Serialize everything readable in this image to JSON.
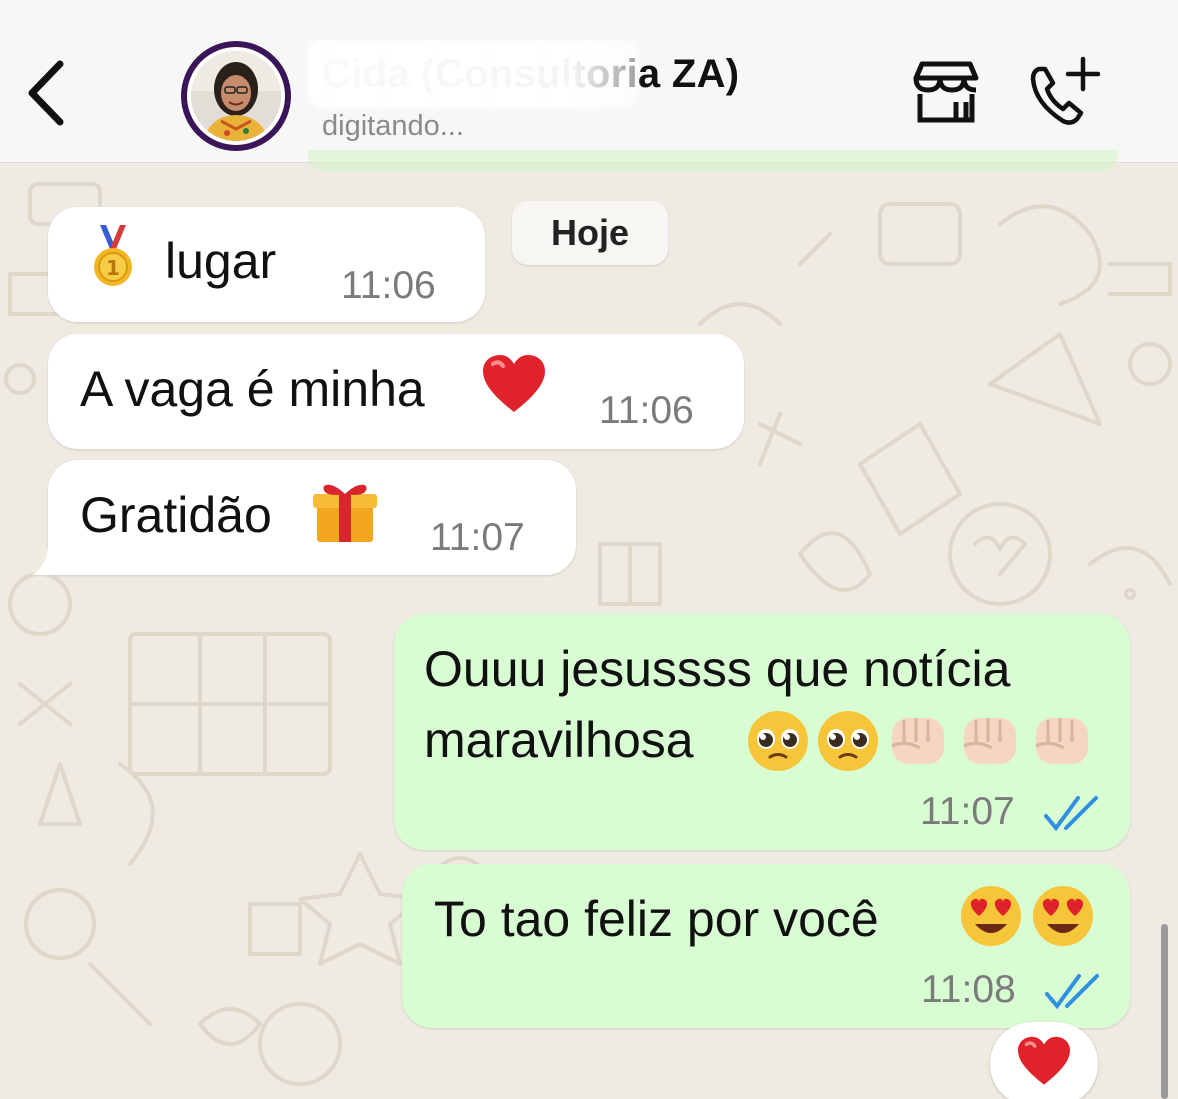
{
  "header": {
    "contact_name": "Cida (Consultoria ZA)",
    "status": "digitando...",
    "back_icon": "chevron-left-icon",
    "store_icon": "storefront-icon",
    "call_icon": "add-call-icon"
  },
  "chat": {
    "date_label": "Hoje",
    "incoming": [
      {
        "text": "lugar",
        "emoji": "medal",
        "time": "11:06"
      },
      {
        "text": "A vaga é minha",
        "emoji": "heart",
        "time": "11:06"
      },
      {
        "text": "Gratidão",
        "emoji": "gift",
        "time": "11:07"
      }
    ],
    "outgoing": [
      {
        "line1": "Ouuu jesussss que notícia",
        "line2": "maravilhosa",
        "emoji": "pleading-faces-and-fists",
        "time": "11:07",
        "status": "read"
      },
      {
        "text": "To tao feliz por você",
        "emoji": "heart-eyes",
        "time": "11:08",
        "status": "read"
      }
    ],
    "reaction": "heart"
  },
  "colors": {
    "incoming_bubble": "#ffffff",
    "outgoing_bubble": "#d9fdd3",
    "read_ticks": "#2f8fe0",
    "wallpaper": "#efeae2",
    "avatar_ring": "#3b1559"
  }
}
